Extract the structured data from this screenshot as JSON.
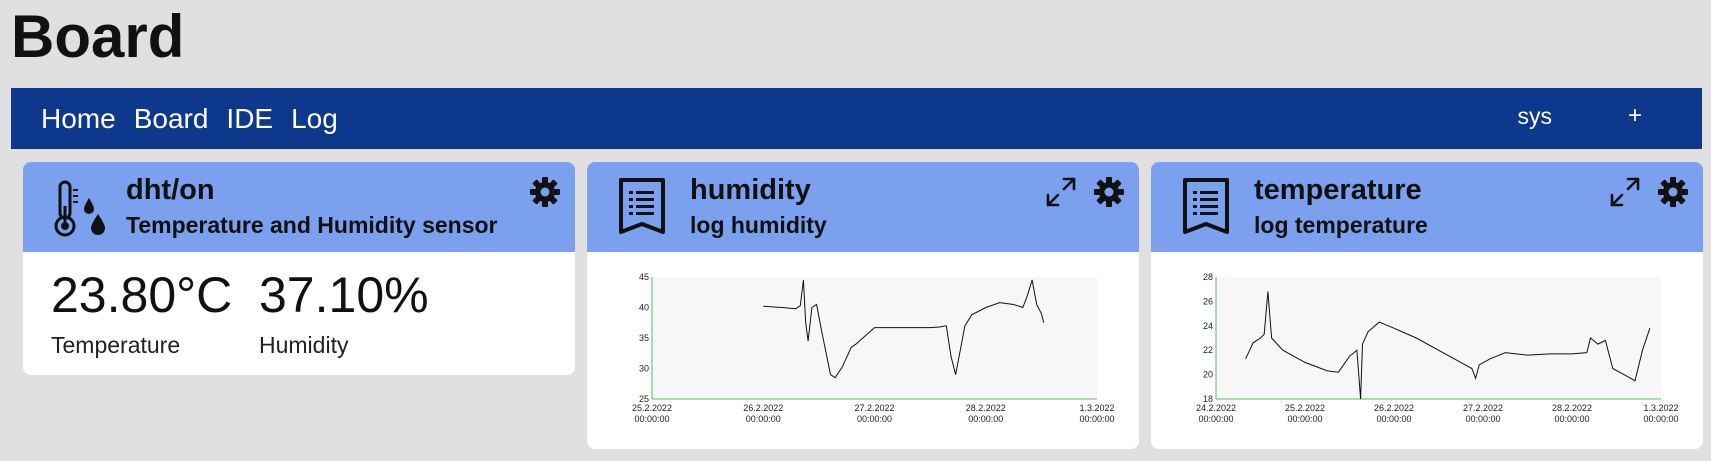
{
  "page": {
    "title": "Board"
  },
  "nav": {
    "items": [
      "Home",
      "Board",
      "IDE",
      "Log"
    ],
    "sys_label": "sys",
    "add_label": "+"
  },
  "cards": {
    "dht": {
      "title": "dht/on",
      "subtitle": "Temperature and Humidity sensor",
      "icon": "thermometer-drops-icon",
      "temperature": {
        "value": "23.80°C",
        "label": "Temperature"
      },
      "humidity": {
        "value": "37.10%",
        "label": "Humidity"
      }
    },
    "humidity": {
      "title": "humidity",
      "subtitle": "log humidity",
      "icon": "log-document-icon"
    },
    "temperature": {
      "title": "temperature",
      "subtitle": "log temperature",
      "icon": "log-document-icon"
    }
  },
  "colors": {
    "background": "#e0e0e0",
    "navbar": "#0e388c",
    "card_header": "#7aa0ee",
    "axis_line": "#5cb85c"
  },
  "chart_data": [
    {
      "type": "line",
      "ylim": [
        25,
        45
      ],
      "yticks": [
        25,
        30,
        35,
        40,
        45
      ],
      "xlim": [
        "2022-02-25",
        "2022-03-01"
      ],
      "xticks": [
        {
          "line1": "25.2.2022",
          "line2": "00:00:00"
        },
        {
          "line1": "26.2.2022",
          "line2": "00:00:00"
        },
        {
          "line1": "27.2.2022",
          "line2": "00:00:00"
        },
        {
          "line1": "28.2.2022",
          "line2": "00:00:00"
        },
        {
          "line1": "1.3.2022",
          "line2": "00:00:00"
        }
      ],
      "series": [
        {
          "points": [
            [
              "2022-02-26 00:00",
              40.2
            ],
            [
              "2022-02-26 04:00",
              40.0
            ],
            [
              "2022-02-26 07:00",
              39.8
            ],
            [
              "2022-02-26 08:00",
              40.3
            ],
            [
              "2022-02-26 08:40",
              44.5
            ],
            [
              "2022-02-26 09:10",
              37.5
            ],
            [
              "2022-02-26 09:40",
              34.5
            ],
            [
              "2022-02-26 10:30",
              40.0
            ],
            [
              "2022-02-26 11:30",
              40.5
            ],
            [
              "2022-02-26 12:30",
              36.5
            ],
            [
              "2022-02-26 14:30",
              29.0
            ],
            [
              "2022-02-26 15:30",
              28.5
            ],
            [
              "2022-02-26 17:00",
              30.2
            ],
            [
              "2022-02-26 19:00",
              33.5
            ],
            [
              "2022-02-26 20:00",
              34.0
            ],
            [
              "2022-02-27 00:00",
              36.7
            ],
            [
              "2022-02-27 12:00",
              36.7
            ],
            [
              "2022-02-27 14:00",
              36.8
            ],
            [
              "2022-02-27 15:30",
              37.0
            ],
            [
              "2022-02-27 16:30",
              32.0
            ],
            [
              "2022-02-27 17:30",
              29.0
            ],
            [
              "2022-02-27 18:30",
              33.0
            ],
            [
              "2022-02-27 19:30",
              37.0
            ],
            [
              "2022-02-27 21:00",
              38.8
            ],
            [
              "2022-02-28 00:00",
              40.0
            ],
            [
              "2022-02-28 03:00",
              40.8
            ],
            [
              "2022-02-28 06:00",
              40.5
            ],
            [
              "2022-02-28 08:00",
              40.0
            ],
            [
              "2022-02-28 09:00",
              42.0
            ],
            [
              "2022-02-28 10:00",
              44.5
            ],
            [
              "2022-02-28 11:00",
              40.5
            ],
            [
              "2022-02-28 12:00",
              39.0
            ],
            [
              "2022-02-28 12:30",
              37.5
            ]
          ]
        }
      ]
    },
    {
      "type": "line",
      "ylim": [
        18,
        28
      ],
      "yticks": [
        18,
        20,
        22,
        24,
        26,
        28
      ],
      "xlim": [
        "2022-02-24",
        "2022-03-01"
      ],
      "xticks": [
        {
          "line1": "24.2.2022",
          "line2": "00:00:00"
        },
        {
          "line1": "25.2.2022",
          "line2": "00:00:00"
        },
        {
          "line1": "26.2.2022",
          "line2": "00:00:00"
        },
        {
          "line1": "27.2.2022",
          "line2": "00:00:00"
        },
        {
          "line1": "28.2.2022",
          "line2": "00:00:00"
        },
        {
          "line1": "1.3.2022",
          "line2": "00:00:00"
        }
      ],
      "series": [
        {
          "points": [
            [
              "2022-02-24 08:00",
              21.3
            ],
            [
              "2022-02-24 10:00",
              22.6
            ],
            [
              "2022-02-24 12:00",
              23.0
            ],
            [
              "2022-02-24 13:00",
              23.3
            ],
            [
              "2022-02-24 14:00",
              26.8
            ],
            [
              "2022-02-24 15:00",
              23.0
            ],
            [
              "2022-02-24 18:00",
              22.0
            ],
            [
              "2022-02-25 00:00",
              21.0
            ],
            [
              "2022-02-25 06:00",
              20.3
            ],
            [
              "2022-02-25 09:00",
              20.2
            ],
            [
              "2022-02-25 12:00",
              21.5
            ],
            [
              "2022-02-25 14:00",
              22.0
            ],
            [
              "2022-02-25 15:00",
              18.0
            ],
            [
              "2022-02-25 15:30",
              22.5
            ],
            [
              "2022-02-25 17:00",
              23.5
            ],
            [
              "2022-02-25 20:00",
              24.3
            ],
            [
              "2022-02-26 00:00",
              23.8
            ],
            [
              "2022-02-26 06:00",
              23.0
            ],
            [
              "2022-02-26 12:00",
              22.0
            ],
            [
              "2022-02-26 18:00",
              21.0
            ],
            [
              "2022-02-26 21:00",
              20.5
            ],
            [
              "2022-02-26 22:00",
              19.7
            ],
            [
              "2022-02-26 23:00",
              20.8
            ],
            [
              "2022-02-27 02:00",
              21.3
            ],
            [
              "2022-02-27 06:00",
              21.8
            ],
            [
              "2022-02-27 12:00",
              21.6
            ],
            [
              "2022-02-27 18:00",
              21.7
            ],
            [
              "2022-02-28 00:00",
              21.7
            ],
            [
              "2022-02-28 04:00",
              21.8
            ],
            [
              "2022-02-28 05:00",
              23.0
            ],
            [
              "2022-02-28 07:00",
              22.5
            ],
            [
              "2022-02-28 09:00",
              22.8
            ],
            [
              "2022-02-28 11:00",
              20.5
            ],
            [
              "2022-02-28 14:00",
              20.0
            ],
            [
              "2022-02-28 17:00",
              19.5
            ],
            [
              "2022-02-28 19:00",
              22.0
            ],
            [
              "2022-02-28 21:00",
              23.8
            ]
          ]
        }
      ]
    }
  ]
}
